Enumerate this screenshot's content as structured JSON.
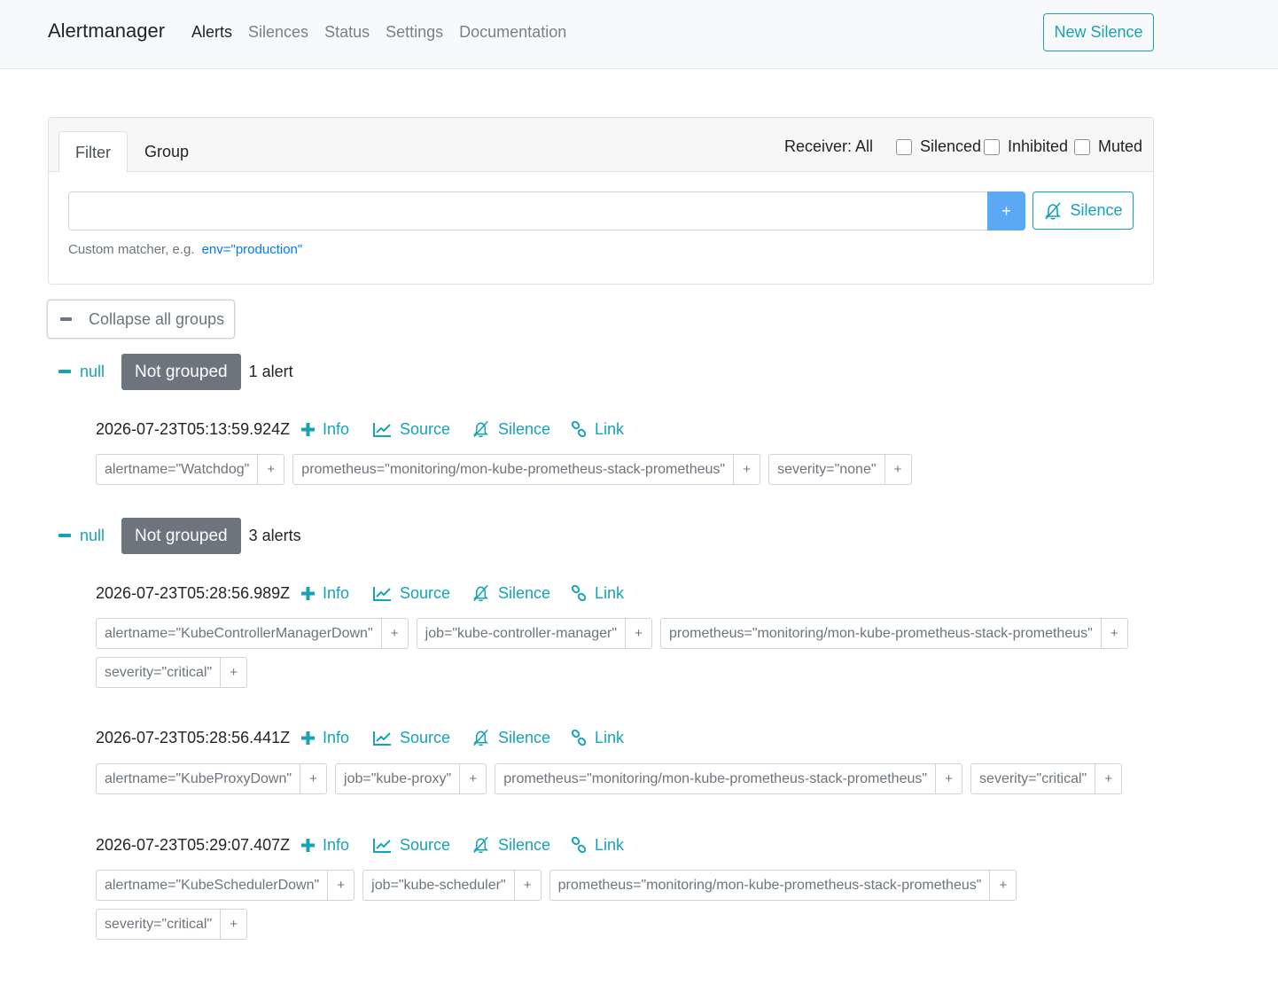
{
  "nav": {
    "brand": "Alertmanager",
    "links": [
      "Alerts",
      "Silences",
      "Status",
      "Settings",
      "Documentation"
    ],
    "new_silence": "New Silence"
  },
  "filter": {
    "tabs": [
      "Filter",
      "Group"
    ],
    "receiver": "Receiver: All",
    "checkboxes": [
      "Silenced",
      "Inhibited",
      "Muted"
    ],
    "input_value": "",
    "add": "+",
    "silence": "Silence",
    "hint": "Custom matcher, e.g.",
    "hint_example": "env=\"production\""
  },
  "collapse_all": "Collapse all groups",
  "actions": {
    "info": "Info",
    "source": "Source",
    "silence": "Silence",
    "link": "Link"
  },
  "groups": [
    {
      "toggle": "null",
      "badge": "Not grouped",
      "count": "1 alert",
      "alerts": [
        {
          "timestamp": "2026-07-23T05:13:59.924Z",
          "labels": [
            "alertname=\"Watchdog\"",
            "prometheus=\"monitoring/mon-kube-prometheus-stack-prometheus\"",
            "severity=\"none\""
          ]
        }
      ]
    },
    {
      "toggle": "null",
      "badge": "Not grouped",
      "count": "3 alerts",
      "alerts": [
        {
          "timestamp": "2026-07-23T05:28:56.989Z",
          "labels": [
            "alertname=\"KubeControllerManagerDown\"",
            "job=\"kube-controller-manager\"",
            "prometheus=\"monitoring/mon-kube-prometheus-stack-prometheus\"",
            "severity=\"critical\""
          ]
        },
        {
          "timestamp": "2026-07-23T05:28:56.441Z",
          "labels": [
            "alertname=\"KubeProxyDown\"",
            "job=\"kube-proxy\"",
            "prometheus=\"monitoring/mon-kube-prometheus-stack-prometheus\"",
            "severity=\"critical\""
          ]
        },
        {
          "timestamp": "2026-07-23T05:29:07.407Z",
          "labels": [
            "alertname=\"KubeSchedulerDown\"",
            "job=\"kube-scheduler\"",
            "prometheus=\"monitoring/mon-kube-prometheus-stack-prometheus\"",
            "severity=\"critical\""
          ]
        }
      ]
    }
  ],
  "label_add": "+",
  "colors": {
    "accent": "#17a2b8",
    "primary": "#5ba8f5",
    "badge": "#6c757d"
  }
}
